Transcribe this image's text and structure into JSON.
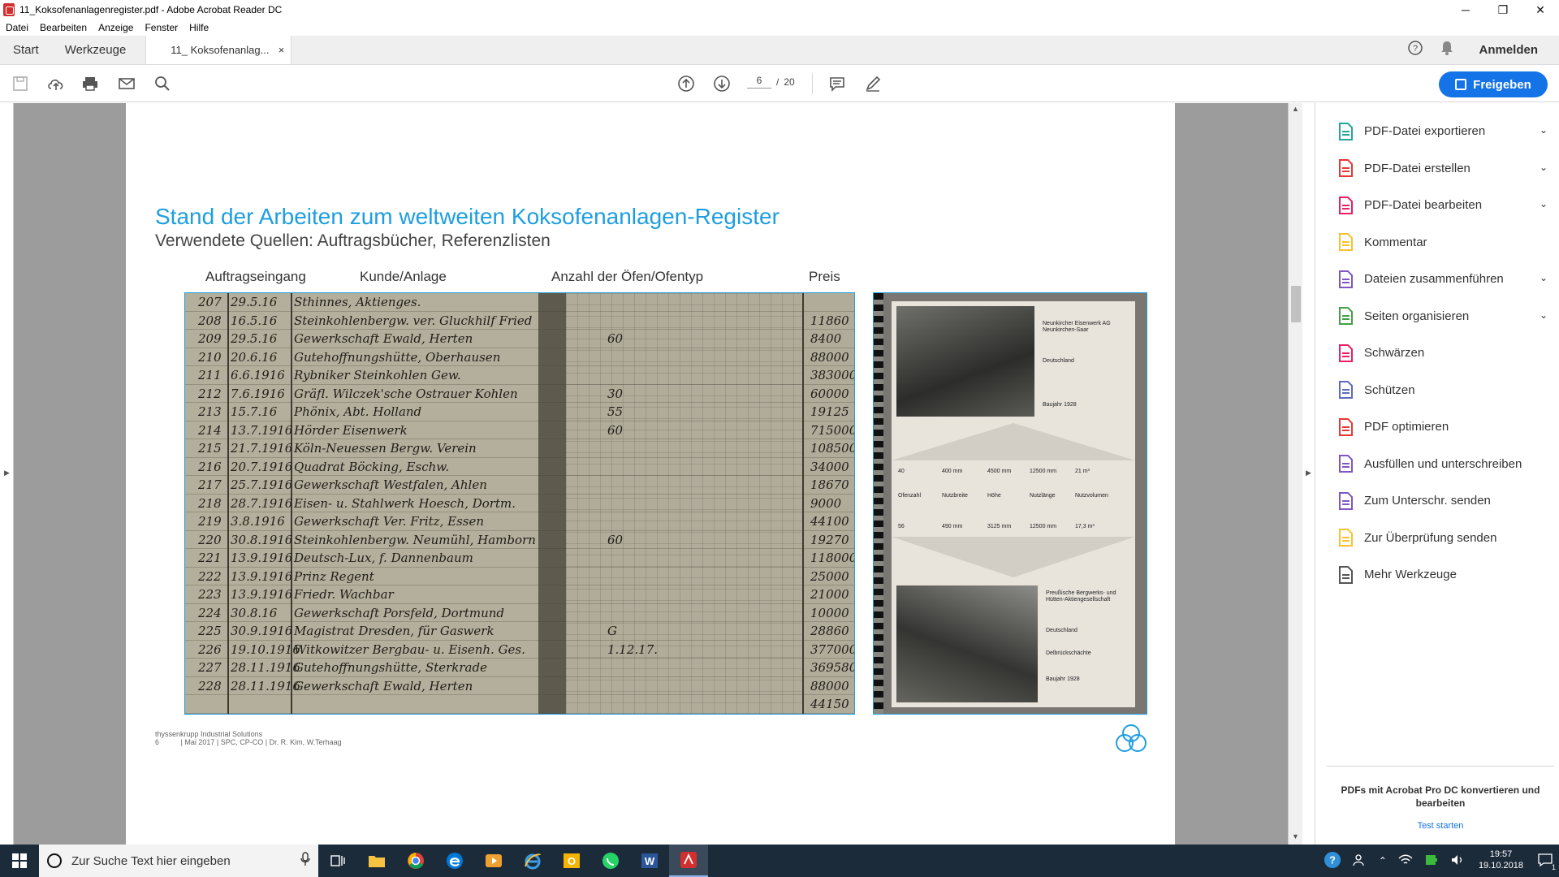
{
  "window": {
    "title": "11_Koksofenanlagenregister.pdf - Adobe Acrobat Reader DC",
    "minimize": "─",
    "maximize": "❐",
    "close": "✕"
  },
  "menu": [
    "Datei",
    "Bearbeiten",
    "Anzeige",
    "Fenster",
    "Hilfe"
  ],
  "tabs": {
    "start": "Start",
    "tools": "Werkzeuge",
    "document": "11_ Koksofenanlag...",
    "close": "×",
    "signin": "Anmelden"
  },
  "toolbar": {
    "current_page": "6",
    "page_sep": "/",
    "total_pages": "20",
    "share_label": "Freigeben"
  },
  "slide": {
    "title": "Stand der Arbeiten zum weltweiten Koksofenanlagen-Register",
    "subtitle": "Verwendete Quellen: Auftragsbücher, Referenzlisten",
    "columns": [
      "Auftragseingang",
      "Kunde/Anlage",
      "Anzahl der Öfen/Ofentyp",
      "Preis"
    ],
    "footer_company": "thyssenkrupp Industrial Solutions",
    "footer_page": "6",
    "footer_meta": "| Mai 2017 | SPC, CP-CO | Dr. R. Kim, W.Terhaag"
  },
  "ledger_rows": [
    {
      "no": "207",
      "date": "29.5.16",
      "customer": "Sthinnes, Aktienges.",
      "ovens": "",
      "price": ""
    },
    {
      "no": "208",
      "date": "16.5.16",
      "customer": "Steinkohlenbergw. ver. Gluckhilf Fried",
      "ovens": "",
      "price": "11860"
    },
    {
      "no": "209",
      "date": "29.5.16",
      "customer": "Gewerkschaft Ewald, Herten",
      "ovens": "60",
      "price": "8400"
    },
    {
      "no": "210",
      "date": "20.6.16",
      "customer": "Gutehoffnungshütte, Oberhausen",
      "ovens": "",
      "price": "88000"
    },
    {
      "no": "211",
      "date": "6.6.1916",
      "customer": "Rybniker Steinkohlen Gew.",
      "ovens": "",
      "price": "383000"
    },
    {
      "no": "212",
      "date": "7.6.1916",
      "customer": "Gräfl. Wilczek'sche Ostrauer Kohlen",
      "ovens": "30",
      "price": "60000"
    },
    {
      "no": "213",
      "date": "15.7.16",
      "customer": "Phönix, Abt. Holland",
      "ovens": "55",
      "price": "19125"
    },
    {
      "no": "214",
      "date": "13.7.1916",
      "customer": "Hörder Eisenwerk",
      "ovens": "60",
      "price": "715000"
    },
    {
      "no": "215",
      "date": "21.7.1916",
      "customer": "Köln-Neuessen Bergw. Verein",
      "ovens": "",
      "price": "1085000"
    },
    {
      "no": "216",
      "date": "20.7.1916",
      "customer": "Quadrat Böcking, Eschw.",
      "ovens": "",
      "price": "34000"
    },
    {
      "no": "217",
      "date": "25.7.1916",
      "customer": "Gewerkschaft Westfalen, Ahlen",
      "ovens": "",
      "price": "18670"
    },
    {
      "no": "218",
      "date": "28.7.1916",
      "customer": "Eisen- u. Stahlwerk Hoesch, Dortm.",
      "ovens": "",
      "price": "9000"
    },
    {
      "no": "219",
      "date": "3.8.1916",
      "customer": "Gewerkschaft Ver. Fritz, Essen",
      "ovens": "",
      "price": "44100"
    },
    {
      "no": "220",
      "date": "30.8.1916",
      "customer": "Steinkohlenbergw. Neumühl, Hamborn",
      "ovens": "60",
      "price": "19270"
    },
    {
      "no": "221",
      "date": "13.9.1916",
      "customer": "Deutsch-Lux, f. Dannenbaum",
      "ovens": "",
      "price": "118000"
    },
    {
      "no": "222",
      "date": "13.9.1916",
      "customer": "Prinz Regent",
      "ovens": "",
      "price": "25000"
    },
    {
      "no": "223",
      "date": "13.9.1916",
      "customer": "Friedr. Wachbar",
      "ovens": "",
      "price": "21000"
    },
    {
      "no": "224",
      "date": "30.8.16",
      "customer": "Gewerkschaft Porsfeld, Dortmund",
      "ovens": "",
      "price": "10000"
    },
    {
      "no": "225",
      "date": "30.9.1916",
      "customer": "Magistrat Dresden, für Gaswerk",
      "ovens": "G",
      "price": "28860"
    },
    {
      "no": "226",
      "date": "19.10.1916",
      "customer": "Witkowitzer Bergbau- u. Eisenh. Ges.",
      "ovens": "1.12.17.",
      "price": "377000"
    },
    {
      "no": "227",
      "date": "28.11.1916",
      "customer": "Gutehoffnungshütte, Sterkrade",
      "ovens": "",
      "price": "369580"
    },
    {
      "no": "228",
      "date": "28.11.1916",
      "customer": "Gewerkschaft Ewald, Herten",
      "ovens": "",
      "price": "88000"
    },
    {
      "no": "",
      "date": "",
      "customer": "",
      "ovens": "",
      "price": "44150"
    }
  ],
  "brochure": {
    "top_company": "Neunkircher Eisenwerk AG Neunkirchen-Saar",
    "top_country": "Deutschland",
    "top_year": "Baujahr 1928",
    "row1": [
      "40",
      "400 mm",
      "4500 mm",
      "12500 mm",
      "21 m³"
    ],
    "labels": [
      "Ofenzahl",
      "Nutzbreite",
      "Höhe",
      "Nutzlänge",
      "Nutzvolumen"
    ],
    "row2": [
      "56",
      "490 mm",
      "3125 mm",
      "12500 mm",
      "17,3 m³"
    ],
    "bottom_company": "Preußische Bergwerks- und Hütten-Aktiengesellschaft",
    "bottom_country": "Deutschland",
    "bottom_site": "Delbrückschächte",
    "bottom_year": "Baujahr 1928"
  },
  "tools_panel": [
    {
      "label": "PDF-Datei exportieren",
      "icon": "export-pdf-icon",
      "color": "#26a69a",
      "chevron": true
    },
    {
      "label": "PDF-Datei erstellen",
      "icon": "create-pdf-icon",
      "color": "#e53935",
      "chevron": true
    },
    {
      "label": "PDF-Datei bearbeiten",
      "icon": "edit-pdf-icon",
      "color": "#e91e63",
      "chevron": true
    },
    {
      "label": "Kommentar",
      "icon": "comment-icon",
      "color": "#fbc02d",
      "chevron": false
    },
    {
      "label": "Dateien zusammenführen",
      "icon": "combine-files-icon",
      "color": "#7e57c2",
      "chevron": true
    },
    {
      "label": "Seiten organisieren",
      "icon": "organize-pages-icon",
      "color": "#43a047",
      "chevron": true
    },
    {
      "label": "Schwärzen",
      "icon": "redact-icon",
      "color": "#e91e63",
      "chevron": false
    },
    {
      "label": "Schützen",
      "icon": "protect-shield-icon",
      "color": "#5c6bc0",
      "chevron": false
    },
    {
      "label": "PDF optimieren",
      "icon": "optimize-pdf-icon",
      "color": "#e53935",
      "chevron": false
    },
    {
      "label": "Ausfüllen und unterschreiben",
      "icon": "fill-sign-icon",
      "color": "#7e57c2",
      "chevron": false
    },
    {
      "label": "Zum Unterschr. senden",
      "icon": "send-for-signature-icon",
      "color": "#7e57c2",
      "chevron": false
    },
    {
      "label": "Zur Überprüfung senden",
      "icon": "send-for-review-icon",
      "color": "#fbc02d",
      "chevron": false
    },
    {
      "label": "Mehr Werkzeuge",
      "icon": "more-tools-icon",
      "color": "#555555",
      "chevron": false
    }
  ],
  "promo": {
    "title": "PDFs mit Acrobat Pro DC konvertieren und bearbeiten",
    "link": "Test starten"
  },
  "taskbar": {
    "search_placeholder": "Zur Suche Text hier eingeben",
    "time": "19:57",
    "date": "19.10.2018",
    "notifications": "1"
  },
  "colors": {
    "accent": "#1473e6",
    "slide_title": "#1e9ee0",
    "taskbar": "#1c2b3a"
  }
}
